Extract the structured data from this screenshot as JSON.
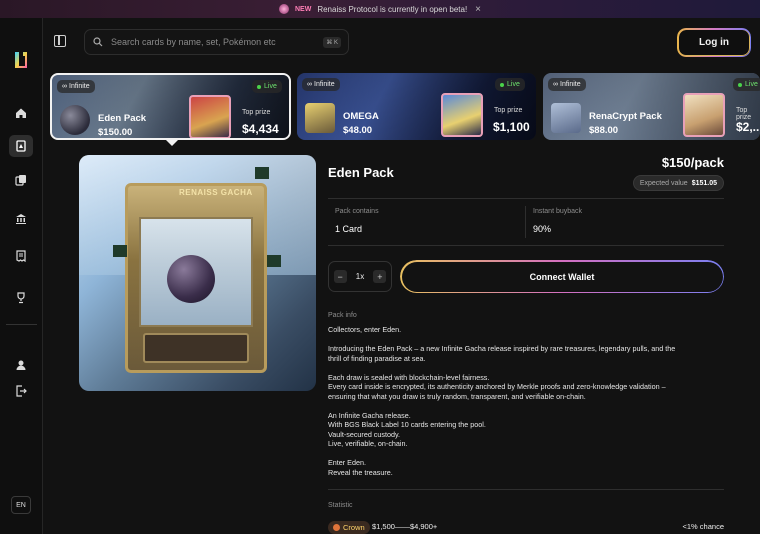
{
  "banner": {
    "new_badge": "NEW",
    "text": "Renaiss Protocol is currently in open beta!",
    "close": "×"
  },
  "search": {
    "placeholder": "Search cards by name, set, Pokémon etc",
    "shortcut": "⌘ K"
  },
  "header": {
    "login_label": "Log in"
  },
  "sidebar": {
    "language": "EN"
  },
  "packs": [
    {
      "tag": "Infinite",
      "live": "Live",
      "name": "Eden Pack",
      "price": "$150.00",
      "prize_label": "Top prize",
      "prize": "$4,434"
    },
    {
      "tag": "Infinite",
      "live": "Live",
      "name": "OMEGA",
      "price": "$48.00",
      "prize_label": "Top prize",
      "prize": "$1,100"
    },
    {
      "tag": "Infinite",
      "live": "Live",
      "name": "RenaCrypt Pack",
      "price": "$88.00",
      "prize_label": "Top prize",
      "prize": "$2,..."
    }
  ],
  "hero": {
    "brand": "RENAISS GACHA"
  },
  "detail": {
    "title": "Eden Pack",
    "price": "$150/pack",
    "expected_label": "Expected value",
    "expected_value": "$151.05",
    "contains_label": "Pack contains",
    "contains_value": "1 Card",
    "buyback_label": "Instant buyback",
    "buyback_value": "90%",
    "quantity": "1x",
    "minus": "−",
    "plus": "+",
    "connect_label": "Connect Wallet",
    "info_label": "Pack info",
    "info_lines": [
      "Collectors, enter Eden.",
      "Introducing the Eden Pack – a new Infinite Gacha release inspired by rare treasures, legendary pulls, and the",
      "thrill of finding paradise at sea.",
      "Each draw is sealed with blockchain-level fairness.",
      "Every card inside is encrypted, its authenticity anchored by Merkle proofs and zero-knowledge validation –",
      "ensuring that what you draw is truly random, transparent, and verifiable on-chain.",
      "An Infinite Gacha release.",
      "With BGS Black Label 10 cards entering the pool.",
      "Vault-secured custody.",
      "Live, verifiable, on-chain.",
      "Enter Eden.",
      "Reveal the treasure."
    ],
    "statistic_label": "Statistic",
    "tier_name": "Crown",
    "tier_range": "$1,500——$4,900+",
    "tier_chance": "<1% chance"
  },
  "colors": {
    "accent_gold": "#e8b54a",
    "accent_pink": "#d47bc4",
    "accent_blue": "#7a7ff0",
    "live_green": "#4ad34a"
  },
  "icons": [
    "toggle-sidebar-icon",
    "search-icon",
    "home-icon",
    "packs-icon",
    "cards-icon",
    "bank-icon",
    "receipt-icon",
    "trophy-icon",
    "user-icon",
    "logout-icon"
  ]
}
